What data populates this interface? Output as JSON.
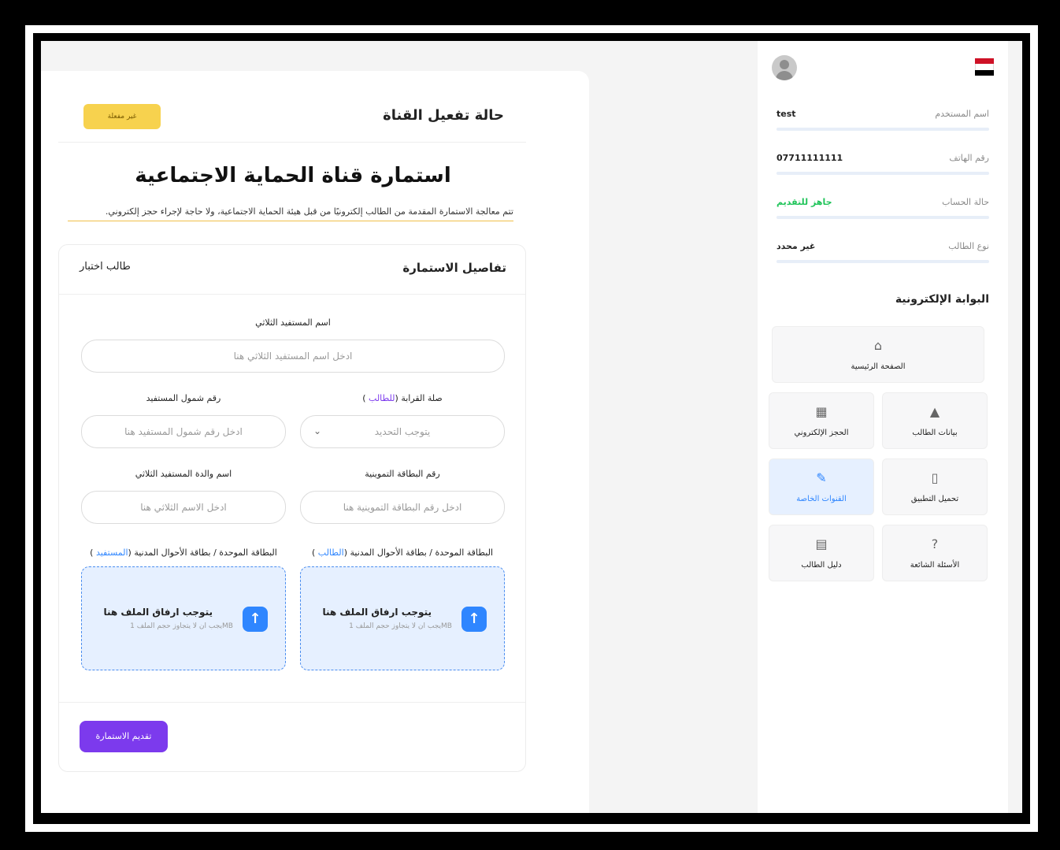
{
  "sidebar": {
    "rows": [
      {
        "label": "اسم المستخدم",
        "value": "test"
      },
      {
        "label": "رقم الهاتف",
        "value": "07711111111"
      },
      {
        "label": "حالة الحساب",
        "value": "جاهز للتقديم"
      },
      {
        "label": "نوع الطالب",
        "value": "غير محدد"
      }
    ],
    "portal_title": "البوابة الإلكترونية",
    "tiles": {
      "home": {
        "label": "الصفحة الرئيسية",
        "icon": "home-icon"
      },
      "student_data": {
        "label": "بيانات الطالب",
        "icon": "student-icon"
      },
      "booking": {
        "label": "الحجز الإلكتروني",
        "icon": "calendar-icon"
      },
      "app_download": {
        "label": "تحميل التطبيق",
        "icon": "phone-icon"
      },
      "special_channels": {
        "label": "القنوات الخاصة",
        "icon": "edit-icon"
      },
      "faq": {
        "label": "الأسئلة الشائعة",
        "icon": "question-icon"
      },
      "guide": {
        "label": "دليل الطالب",
        "icon": "book-icon"
      }
    },
    "colors": {
      "green": "#20c45a",
      "active": "#2f86ff"
    }
  },
  "main": {
    "status_title": "حالة تفعيل القناة",
    "status_badge": "غير مفعلة",
    "form_title": "استمارة قناة الحماية الاجتماعية",
    "form_note": "تتم معالجة الاستمارة المقدمة من الطالب إلكترونيًا من قبل هيئة الحماية الاجتماعية، ولا حاجة لإجراء حجز إلكتروني.",
    "details_title": "تفاصيل الاستمارة",
    "student_type": "طالب اختبار",
    "fields": {
      "beneficiary_name": {
        "label": "اسم المستفيد الثلاثي",
        "placeholder": "ادخل اسم المستفيد الثلاثي هنا"
      },
      "relation": {
        "label_prefix": "صلة القرابة (",
        "label_hl": "للطالب",
        "label_suffix": " )",
        "placeholder": "يتوجب التحديد"
      },
      "coverage_no": {
        "label": "رقم شمول المستفيد",
        "placeholder": "ادخل رقم شمول المستفيد هنا"
      },
      "ration_card": {
        "label": "رقم البطاقة التموينية",
        "placeholder": "ادخل رقم البطاقة التموينية هنا"
      },
      "mother_name": {
        "label": "اسم والدة المستفيد الثلاثي",
        "placeholder": "ادخل الاسم الثلاثي هنا"
      },
      "id_student": {
        "label_prefix": "البطاقة الموحدة / بطاقة الأحوال المدنية (",
        "label_hl": "الطالب",
        "label_suffix": " )"
      },
      "id_beneficiary": {
        "label_prefix": "البطاقة الموحدة / بطاقة الأحوال المدنية (",
        "label_hl": "المستفيد",
        "label_suffix": " )"
      }
    },
    "upload": {
      "title": "يتوجب ارفاق الملف هنا",
      "hint": "يجب ان لا يتجاوز حجم الملف 1MB",
      "icon": "upload-icon"
    },
    "submit_label": "تقديم الاستمارة",
    "colors": {
      "badge": "#f7d24e",
      "submit": "#7c3aed",
      "drop": "#e6f0ff"
    }
  }
}
